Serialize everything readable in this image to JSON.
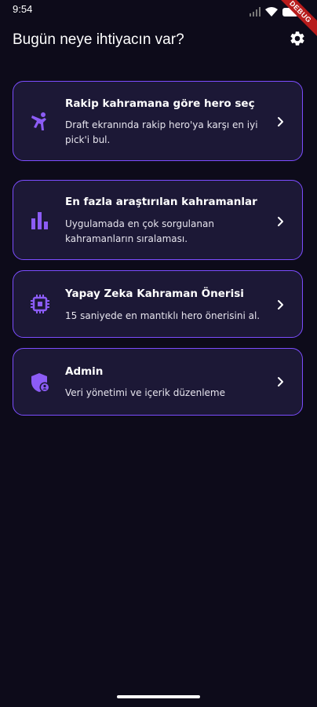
{
  "status_bar": {
    "time": "9:54",
    "debug_label": "DEBUG"
  },
  "header": {
    "title": "Bugün neye ihtiyacın var?",
    "settings_icon": "gear-icon"
  },
  "cards": [
    {
      "title": "Rakip kahramana göre hero seç",
      "description": "Draft ekranında rakip hero'ya karşı en iyi pick'i bul.",
      "icon": "martial-arts-icon"
    },
    {
      "title": "En fazla araştırılan kahramanlar",
      "description": "Uygulamada en çok sorgulanan kahramanların sıralaması.",
      "icon": "bar-chart-icon"
    },
    {
      "title": "Yapay Zeka Kahraman Önerisi",
      "description": "15 saniyede en mantıklı hero önerisini al.",
      "icon": "chip-icon"
    },
    {
      "title": "Admin",
      "description": "Veri yönetimi ve içerik düzenleme",
      "icon": "admin-shield-icon"
    }
  ],
  "colors": {
    "background": "#0d0b1a",
    "card_background": "#1c1836",
    "accent": "#7c4dff",
    "icon": "#8c5cf6"
  }
}
